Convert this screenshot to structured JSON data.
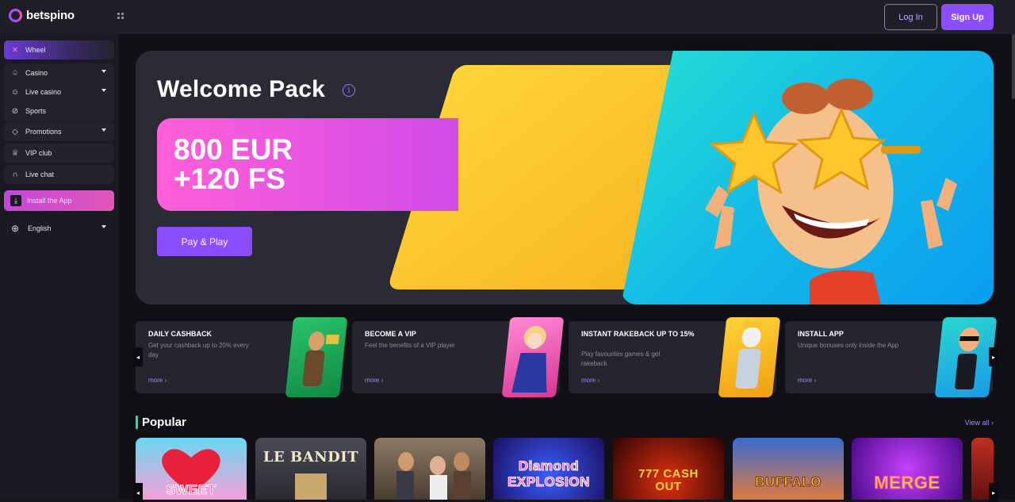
{
  "header": {
    "logo_text": "betspino",
    "login_label": "Log In",
    "signup_label": "Sign Up"
  },
  "sidebar": {
    "items": [
      {
        "label": "Wheel",
        "icon": "wheel-icon"
      },
      {
        "label": "Casino",
        "icon": "spade-icon"
      },
      {
        "label": "Live casino",
        "icon": "live-dealer-icon"
      },
      {
        "label": "Sports",
        "icon": "ball-icon"
      },
      {
        "label": "Promotions",
        "icon": "tag-icon"
      },
      {
        "label": "VIP club",
        "icon": "crown-icon"
      },
      {
        "label": "Live chat",
        "icon": "headset-icon"
      },
      {
        "label": "Install the App",
        "icon": "download-icon"
      },
      {
        "label": "English",
        "icon": "globe-icon"
      }
    ]
  },
  "hero": {
    "title": "Welcome Pack",
    "line1": "800 EUR",
    "line2": "+120 FS",
    "button_label": "Pay & Play"
  },
  "promos": [
    {
      "title": "DAILY CASHBACK",
      "desc": "Get your cashback up to 20% every day",
      "more": "more"
    },
    {
      "title": "BECOME A VIP",
      "desc": "Feel the benefits of a VIP player",
      "more": "more"
    },
    {
      "title": "INSTANT RAKEBACK UP TO 15%",
      "desc": "Play favourites games & get rakeback",
      "more": "more"
    },
    {
      "title": "INSTALL APP",
      "desc": "Unique bonuses only inside the App",
      "more": "more"
    }
  ],
  "popular": {
    "title": "Popular",
    "view_all": "View all",
    "games": [
      "SWEET",
      "LE BANDIT",
      "",
      "Diamond EXPLOSION",
      "777 CASH OUT",
      "BUFFALO",
      "MERGE"
    ]
  },
  "colors": {
    "accent": "#8a4dff",
    "pink": "#ff5fd8",
    "popular_marker": "#22e0a4"
  }
}
